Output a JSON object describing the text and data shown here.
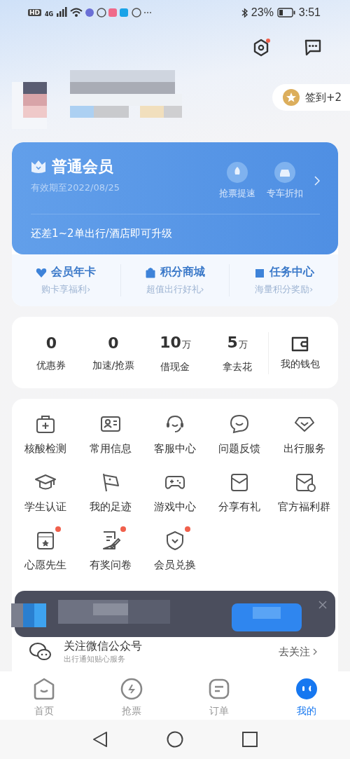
{
  "status_bar": {
    "hd": "HD",
    "network": "4G",
    "battery_text": "23%",
    "time": "3:51"
  },
  "header": {
    "settings_badge": true,
    "checkin": "签到+2"
  },
  "member_card": {
    "level": "普通会员",
    "expiry": "有效期至2022/08/25",
    "perks": [
      "抢票提速",
      "专车折扣"
    ],
    "upgrade": "还差1~2单出行/酒店即可升级"
  },
  "benefits": [
    {
      "title": "会员年卡",
      "subtitle": "购卡享福利›"
    },
    {
      "title": "积分商城",
      "subtitle": "超值出行好礼›"
    },
    {
      "title": "任务中心",
      "subtitle": "海量积分奖励›"
    }
  ],
  "stats": [
    {
      "value": "0",
      "label": "优惠券"
    },
    {
      "value": "0",
      "label": "加速/抢票"
    },
    {
      "value": "10",
      "unit": "万",
      "label": "借现金"
    },
    {
      "value": "5",
      "unit": "万",
      "label": "拿去花"
    }
  ],
  "wallet": {
    "label": "我的钱包"
  },
  "services": [
    {
      "label": "核酸检测",
      "badge": false
    },
    {
      "label": "常用信息",
      "badge": false
    },
    {
      "label": "客服中心",
      "badge": false
    },
    {
      "label": "问题反馈",
      "badge": false
    },
    {
      "label": "出行服务",
      "badge": false
    },
    {
      "label": "学生认证",
      "badge": false
    },
    {
      "label": "我的足迹",
      "badge": false
    },
    {
      "label": "游戏中心",
      "badge": false
    },
    {
      "label": "分享有礼",
      "badge": false
    },
    {
      "label": "官方福利群",
      "badge": false
    },
    {
      "label": "心愿先生",
      "badge": true
    },
    {
      "label": "有奖问卷",
      "badge": true
    },
    {
      "label": "会员兑换",
      "badge": true
    }
  ],
  "wechat_row": {
    "title": "关注微信公众号",
    "subtitle": "出行通知贴心服务",
    "action": "去关注"
  },
  "tabs": [
    {
      "label": "首页",
      "selected": false
    },
    {
      "label": "抢票",
      "selected": false
    },
    {
      "label": "订单",
      "selected": false
    },
    {
      "label": "我的",
      "selected": true
    }
  ]
}
